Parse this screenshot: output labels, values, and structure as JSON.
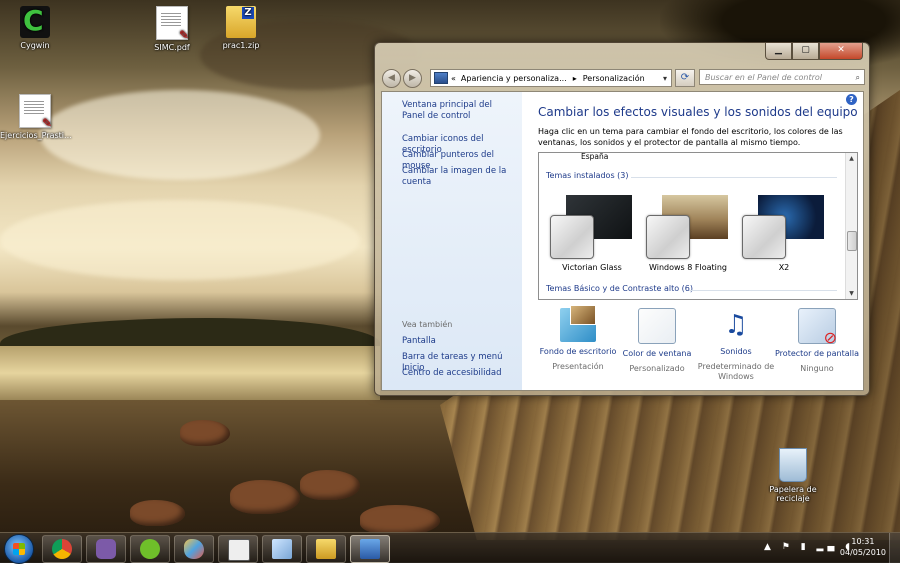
{
  "desktop": {
    "icons": [
      {
        "label": "Cygwin"
      },
      {
        "label": "SIMC.pdf"
      },
      {
        "label": "prac1.zip"
      },
      {
        "label": "Ejercicios_Prasti..."
      },
      {
        "label": "Papelera de reciclaje"
      }
    ]
  },
  "window": {
    "caption_buttons": [
      "minimize",
      "maximize",
      "close"
    ],
    "nav": {
      "address_prefix": "«",
      "breadcrumb_1": "Apariencia y personaliza...",
      "separator": "▸",
      "breadcrumb_2": "Personalización",
      "search_placeholder": "Buscar en el Panel de control"
    },
    "left_panel": {
      "home_link": "Ventana principal del Panel de control",
      "links": [
        "Cambiar iconos del escritorio",
        "Cambiar punteros del mouse",
        "Cambiar la imagen de la cuenta"
      ],
      "see_also_label": "Vea también",
      "see_also": [
        "Pantalla",
        "Barra de tareas y menú Inicio",
        "Centro de accesibilidad"
      ]
    },
    "main": {
      "title": "Cambiar los efectos visuales y los sonidos del equipo",
      "description": "Haga clic en un tema para cambiar el fondo del escritorio, los colores de las ventanas, los sonidos y el protector de pantalla al mismo tiempo.",
      "partial_theme": "España",
      "installed_header": "Temas instalados (3)",
      "themes": [
        {
          "name": "Victorian Glass"
        },
        {
          "name": "Windows 8 Floating"
        },
        {
          "name": "X2"
        }
      ],
      "basic_header": "Temas Básico y de Contraste alto (6)"
    },
    "bottom": [
      {
        "label": "Fondo de escritorio",
        "value": "Presentación",
        "icon": "wallpaper-icon"
      },
      {
        "label": "Color de ventana",
        "value": "Personalizado",
        "icon": "window-color-icon"
      },
      {
        "label": "Sonidos",
        "value": "Predeterminado de Windows",
        "icon": "sounds-icon"
      },
      {
        "label": "Protector de pantalla",
        "value": "Ninguno",
        "icon": "screensaver-icon"
      }
    ]
  },
  "taskbar": {
    "time": "10:31",
    "date": "04/05/2010",
    "apps": [
      "chrome",
      "pidgin",
      "spotify",
      "paint",
      "calendar",
      "window-switcher",
      "explorer",
      "control-panel"
    ],
    "tray_icons": "▲ ⚑ ▮ ▂▄ ◖"
  },
  "colors": {
    "link": "#1e3c8a",
    "title": "#1e3a8a"
  }
}
